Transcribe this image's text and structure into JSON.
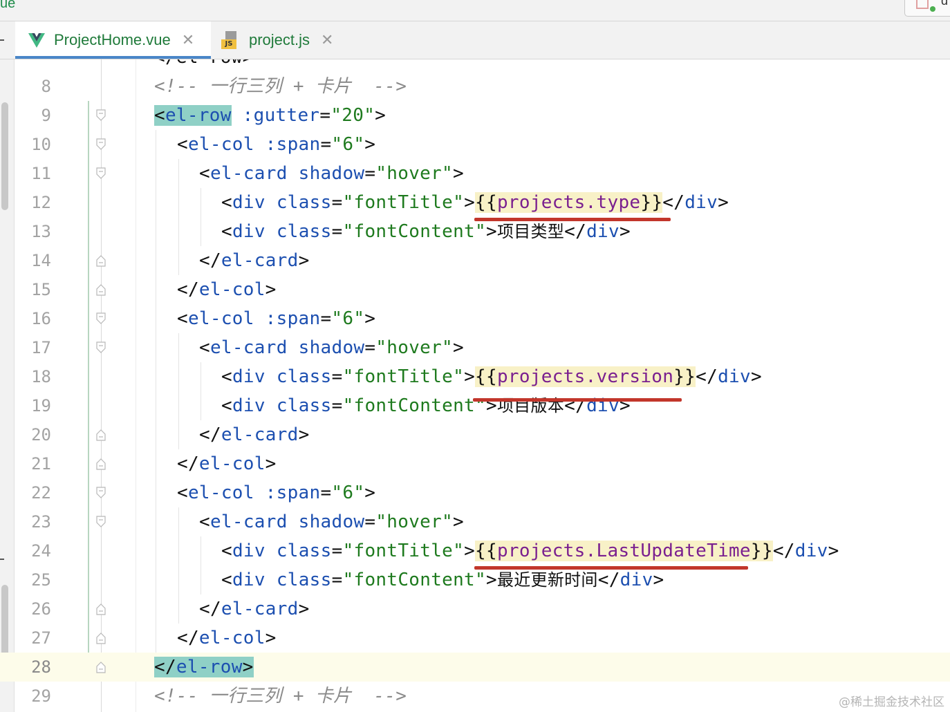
{
  "window": {
    "breadcrumb_fragment": "ue",
    "corner_button_text": "d"
  },
  "tabs": [
    {
      "label": "ProjectHome.vue",
      "active": true,
      "icon": "vue-icon"
    },
    {
      "label": "project.js",
      "active": false,
      "icon": "js-icon",
      "badge": "JS"
    }
  ],
  "editor": {
    "partial_top_line": "</el-row>",
    "current_line": 28,
    "lines": [
      {
        "n": "8",
        "fold": "none"
      },
      {
        "n": "9",
        "fold": "open"
      },
      {
        "n": "10",
        "fold": "open"
      },
      {
        "n": "11",
        "fold": "open"
      },
      {
        "n": "12",
        "fold": "none"
      },
      {
        "n": "13",
        "fold": "none"
      },
      {
        "n": "14",
        "fold": "close"
      },
      {
        "n": "15",
        "fold": "close"
      },
      {
        "n": "16",
        "fold": "open"
      },
      {
        "n": "17",
        "fold": "open"
      },
      {
        "n": "18",
        "fold": "none"
      },
      {
        "n": "19",
        "fold": "none"
      },
      {
        "n": "20",
        "fold": "close"
      },
      {
        "n": "21",
        "fold": "close"
      },
      {
        "n": "22",
        "fold": "open"
      },
      {
        "n": "23",
        "fold": "open"
      },
      {
        "n": "24",
        "fold": "none"
      },
      {
        "n": "25",
        "fold": "none"
      },
      {
        "n": "26",
        "fold": "close"
      },
      {
        "n": "27",
        "fold": "close"
      },
      {
        "n": "28",
        "fold": "close"
      },
      {
        "n": "29",
        "fold": "none"
      }
    ],
    "text": {
      "comment": "<!-- 一行三列 + 卡片  -->",
      "lt": "<",
      "ltslash": "</",
      "gt": ">",
      "el_row": "el-row",
      "el_col": "el-col",
      "el_card": "el-card",
      "div": "div",
      "gutter_attr": ":gutter",
      "gutter_val": "\"20\"",
      "span_attr": ":span",
      "span_val": "\"6\"",
      "shadow_attr": "shadow",
      "shadow_val": "\"hover\"",
      "class_attr": "class",
      "font_title": "\"fontTitle\"",
      "font_content": "\"fontContent\"",
      "eq": "=",
      "mus_open": "{{",
      "mus_close": "}}",
      "title_1": "projects.type",
      "title_2": "projects.version",
      "title_3": "projects.LastUpdateTime",
      "content_1": "项目类型",
      "content_2": "项目版本",
      "content_3": "最近更新时间"
    }
  },
  "watermark": "@稀土掘金技术社区"
}
